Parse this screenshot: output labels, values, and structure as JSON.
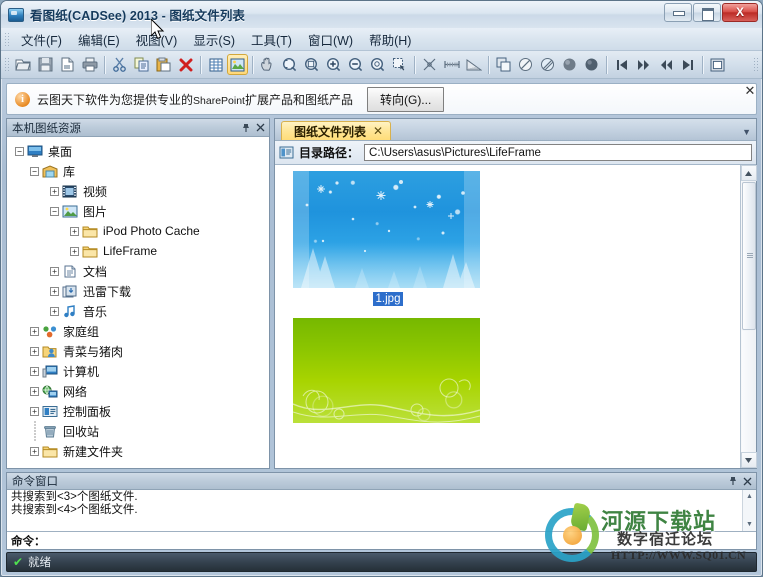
{
  "window": {
    "title": "看图纸(CADSee) 2013 - 图纸文件列表",
    "app_icon": "cadsee-app-icon",
    "controls": {
      "minimize": "",
      "maximize": "",
      "close": "X"
    }
  },
  "menu": {
    "items": [
      {
        "label": "文件(F)",
        "name": "menu-file"
      },
      {
        "label": "编辑(E)",
        "name": "menu-edit"
      },
      {
        "label": "视图(V)",
        "name": "menu-view"
      },
      {
        "label": "显示(S)",
        "name": "menu-display"
      },
      {
        "label": "工具(T)",
        "name": "menu-tools"
      },
      {
        "label": "窗口(W)",
        "name": "menu-window"
      },
      {
        "label": "帮助(H)",
        "name": "menu-help"
      }
    ]
  },
  "toolbar": {
    "buttons": [
      "open-icon",
      "save-icon",
      "save-as-icon",
      "print-icon",
      "cut-icon",
      "copy-icon",
      "paste-icon",
      "delete-icon",
      "table-icon",
      "image-list-icon",
      "pan-icon",
      "zoom-window-icon",
      "zoom-extents-icon",
      "zoom-in-icon",
      "zoom-out-icon",
      "zoom-previous-icon",
      "zoom-selection-icon",
      "measure-point-icon",
      "measure-distance-icon",
      "measure-angle-icon",
      "layer-icon",
      "hatch-off-icon",
      "hatch-on-icon",
      "shade-gray-icon",
      "shade-dark-icon",
      "first-icon",
      "next-fast-icon",
      "prev-fast-icon",
      "last-icon",
      "fullscreen-icon"
    ]
  },
  "infobar": {
    "icon": "info-icon",
    "text_prefix": "云图天下软件为您提供专业的",
    "text_en": "SharePoint",
    "text_suffix": "扩展产品和图纸产品",
    "button": "转向(G)...",
    "close": "✕"
  },
  "sidebar": {
    "title": "本机图纸资源",
    "pin_icon": "pin-icon",
    "close_icon": "close-icon",
    "tree": [
      {
        "label": "桌面",
        "depth": 0,
        "expander": "-",
        "icon": "desktop-icon"
      },
      {
        "label": "库",
        "depth": 1,
        "expander": "-",
        "icon": "library-icon"
      },
      {
        "label": "视频",
        "depth": 2,
        "expander": "+",
        "icon": "video-icon"
      },
      {
        "label": "图片",
        "depth": 2,
        "expander": "-",
        "icon": "pictures-icon"
      },
      {
        "label": "iPod Photo Cache",
        "depth": 3,
        "expander": "+",
        "icon": "folder-icon"
      },
      {
        "label": "LifeFrame",
        "depth": 3,
        "expander": "+",
        "icon": "folder-icon"
      },
      {
        "label": "文档",
        "depth": 2,
        "expander": "+",
        "icon": "documents-icon"
      },
      {
        "label": "迅雷下载",
        "depth": 2,
        "expander": "+",
        "icon": "download-icon"
      },
      {
        "label": "音乐",
        "depth": 2,
        "expander": "+",
        "icon": "music-icon"
      },
      {
        "label": "家庭组",
        "depth": 1,
        "expander": "+",
        "icon": "homegroup-icon"
      },
      {
        "label": "青菜与猪肉",
        "depth": 1,
        "expander": "+",
        "icon": "user-icon"
      },
      {
        "label": "计算机",
        "depth": 1,
        "expander": "+",
        "icon": "computer-icon"
      },
      {
        "label": "网络",
        "depth": 1,
        "expander": "+",
        "icon": "network-icon"
      },
      {
        "label": "控制面板",
        "depth": 1,
        "expander": "+",
        "icon": "control-panel-icon"
      },
      {
        "label": "回收站",
        "depth": 1,
        "expander": "",
        "icon": "recycle-bin-icon"
      },
      {
        "label": "新建文件夹",
        "depth": 1,
        "expander": "+",
        "icon": "folder-icon"
      }
    ]
  },
  "document": {
    "tab": {
      "label": "图纸文件列表",
      "close": "✕"
    },
    "tab_dropdown": "chevron-down-icon",
    "path": {
      "icon": "folder-path-icon",
      "label": "目录路径：",
      "value": "C:\\Users\\asus\\Pictures\\LifeFrame"
    },
    "files": [
      {
        "name": "1.jpg",
        "selected": true,
        "thumb": "winter-blue-snow"
      },
      {
        "name": "",
        "selected": false,
        "thumb": "green-gradient-swirl"
      }
    ]
  },
  "command_window": {
    "title": "命令窗口",
    "pin_icon": "pin-icon",
    "close_icon": "close-icon",
    "lines": [
      "共搜索到<3>个图纸文件.",
      "共搜索到<4>个图纸文件."
    ],
    "prompt": "命令："
  },
  "statusbar": {
    "check": "✔",
    "text": "就绪"
  },
  "watermark": {
    "line1": "河源下载站",
    "line2": "数字宿迁论坛",
    "line3": "HTTP://WWW.SQ01.CN"
  },
  "colors": {
    "titlebar": "#dbe6f1",
    "accent_tab": "#ffdd78",
    "selection": "#2d6ecb",
    "close_button": "#d9504a",
    "status_bg": "#35424f",
    "status_check": "#4fe14f"
  }
}
